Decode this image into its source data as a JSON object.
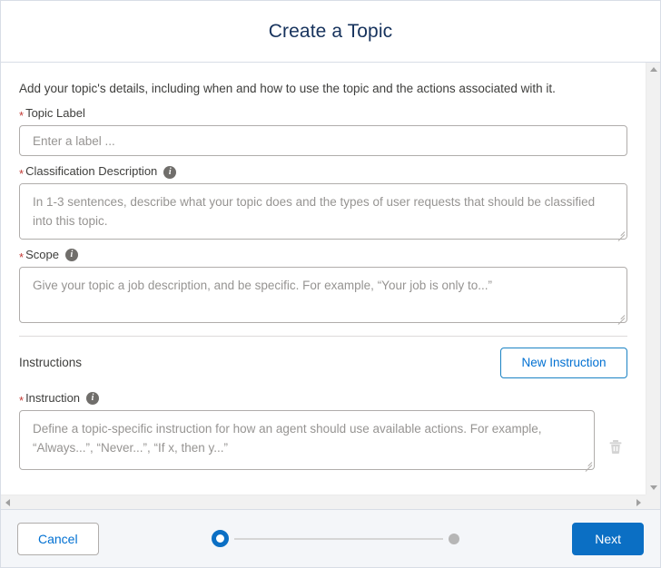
{
  "header": {
    "title": "Create a Topic"
  },
  "body": {
    "intro": "Add your topic's details, including when and how to use the topic and the actions associated with it.",
    "fields": {
      "topic_label": {
        "label": "Topic Label",
        "required_marker": "*",
        "placeholder": "Enter a label ...",
        "value": ""
      },
      "classification_description": {
        "label": "Classification Description",
        "required_marker": "*",
        "info_icon": "info-icon",
        "placeholder": "In 1-3 sentences, describe what your topic does and the types of user requests that should be classified into this topic.",
        "value": ""
      },
      "scope": {
        "label": "Scope",
        "required_marker": "*",
        "info_icon": "info-icon",
        "placeholder": "Give your topic a job description, and be specific. For example, “Your job is only to...”",
        "value": ""
      }
    },
    "instructions": {
      "section_title": "Instructions",
      "new_instruction_label": "New Instruction",
      "instruction": {
        "label": "Instruction",
        "required_marker": "*",
        "info_icon": "info-icon",
        "placeholder": "Define a topic-specific instruction for how an agent should use available actions. For example, “Always...”, “Never...”, “If x, then y...”",
        "value": "",
        "delete_icon": "trash-icon"
      }
    }
  },
  "footer": {
    "cancel_label": "Cancel",
    "next_label": "Next",
    "progress": {
      "total_steps": 2,
      "current_step": 1
    }
  },
  "colors": {
    "brand_blue": "#0b6fc4",
    "link_blue": "#0070d2",
    "required_red": "#c23934",
    "footer_bg": "#f4f6f9",
    "border_grey": "#b0adab",
    "info_grey": "#706e6b",
    "step_inactive": "#b6b6b6"
  }
}
